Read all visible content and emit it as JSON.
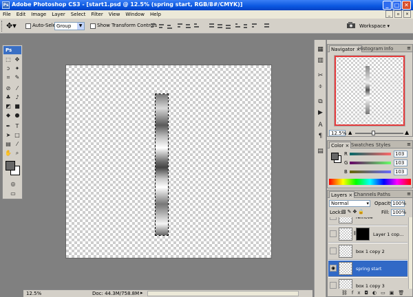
{
  "window": {
    "title": "Adobe Photoshop CS3 - [start1.psd @ 12.5% (spring start, RGB/8#/CMYK)]",
    "app_icon": "Ps",
    "minimize": "_",
    "maximize": "□",
    "close": "✕"
  },
  "menu": [
    "File",
    "Edit",
    "Image",
    "Layer",
    "Select",
    "Filter",
    "View",
    "Window",
    "Help"
  ],
  "options": {
    "auto_select_label": "Auto-Select:",
    "auto_select_value": "Group",
    "show_transform_label": "Show Transform Controls",
    "workspace_label": "Workspace ▾"
  },
  "toolbox": {
    "logo": "Ps",
    "colors": {
      "foreground": "#676767",
      "background": "#ffffff"
    }
  },
  "status": {
    "zoom": "12.5%",
    "doc": "Doc: 44.3M/758.8M"
  },
  "navigator": {
    "tabs": [
      "Navigator",
      "Histogram",
      "Info"
    ],
    "zoom": "12.5%"
  },
  "color_panel": {
    "tabs": [
      "Color",
      "Swatches",
      "Styles"
    ],
    "channels": [
      {
        "name": "R",
        "value": "103"
      },
      {
        "name": "G",
        "value": "103"
      },
      {
        "name": "B",
        "value": "103"
      }
    ]
  },
  "layers_panel": {
    "tabs": [
      "Layers",
      "Channels",
      "Paths"
    ],
    "blend_mode": "Normal",
    "opacity_label": "Opacity:",
    "opacity": "100%",
    "lock_label": "Lock:",
    "fill_label": "Fill:",
    "fill": "100%",
    "layers": [
      {
        "name": "remove",
        "visible": false,
        "selected": false,
        "mask": false
      },
      {
        "name": "Layer 1 cop...",
        "visible": false,
        "selected": false,
        "mask": true
      },
      {
        "name": "box 1 copy 2",
        "visible": false,
        "selected": false,
        "mask": false
      },
      {
        "name": "spring start",
        "visible": true,
        "selected": true,
        "mask": false
      },
      {
        "name": "box 1 copy 3",
        "visible": false,
        "selected": false,
        "mask": false
      }
    ]
  },
  "accent_color": "#3169c6"
}
